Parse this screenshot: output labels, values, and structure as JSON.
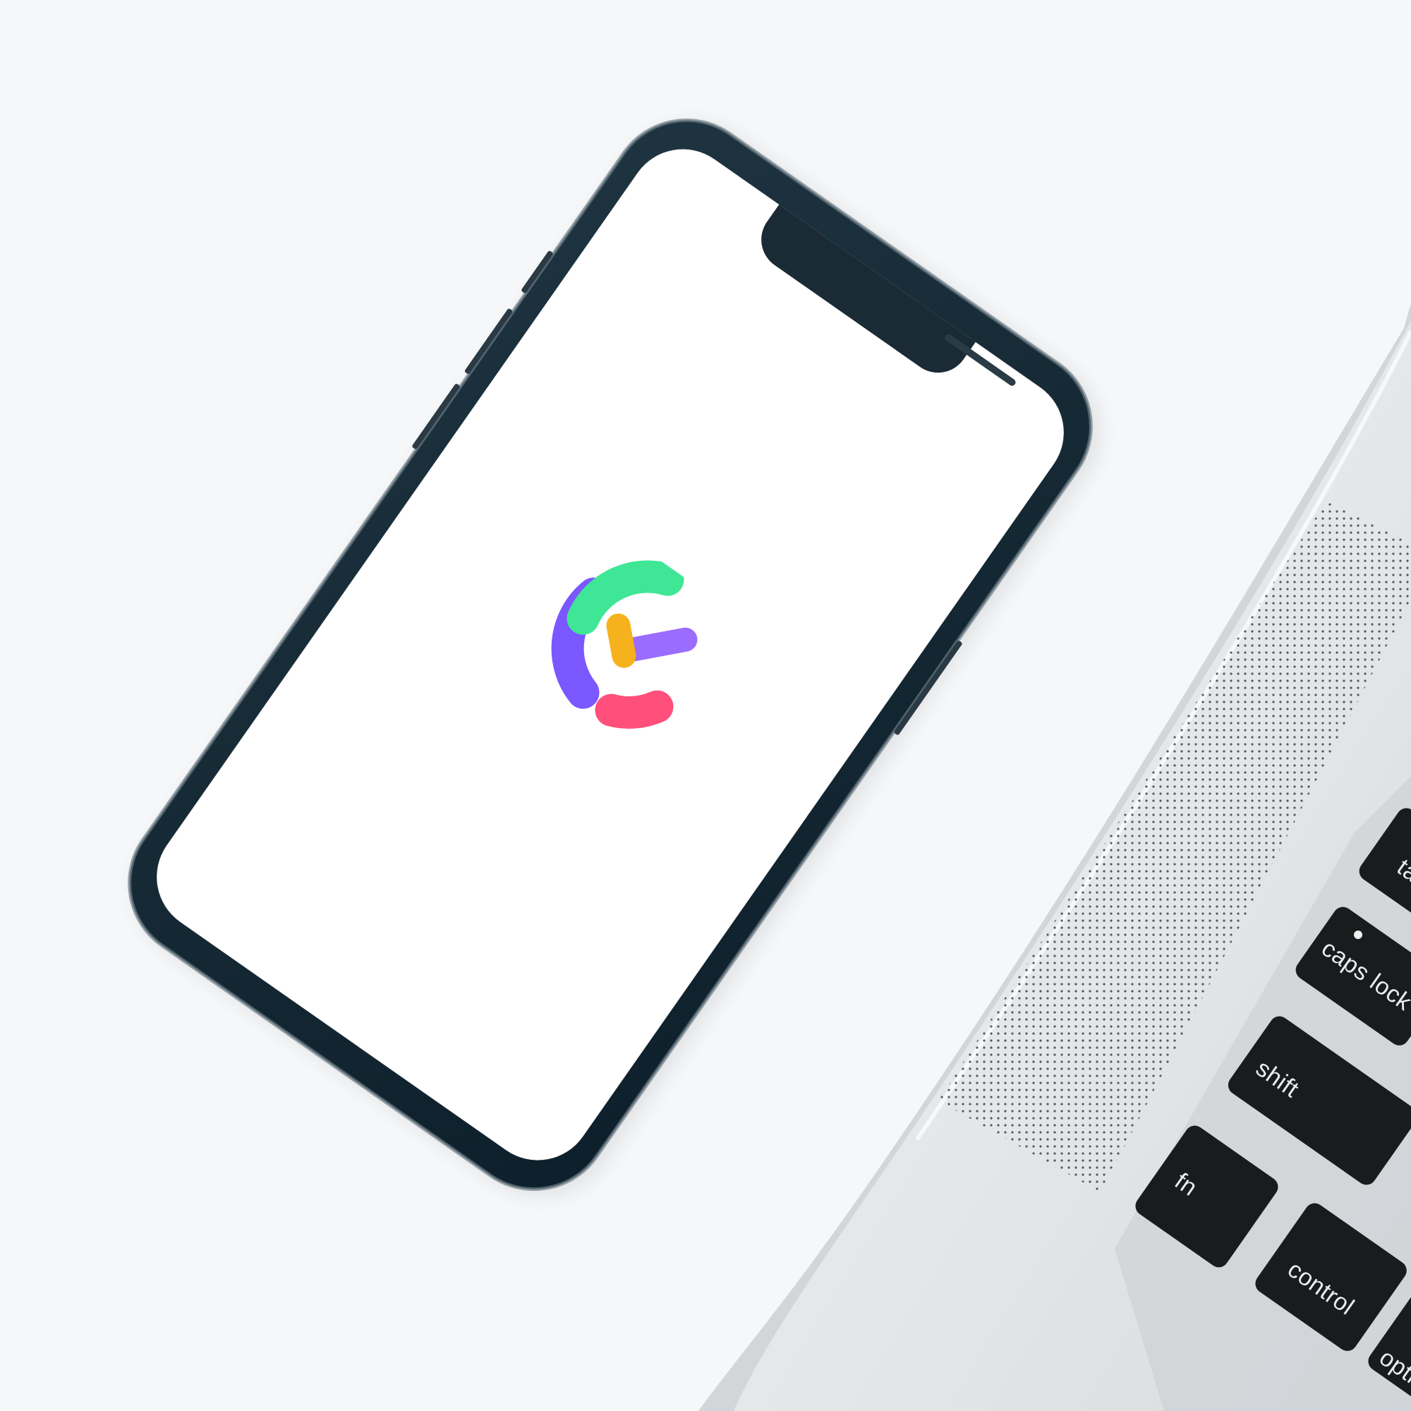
{
  "scene": {
    "background_color": "#f3f4f6",
    "laptop_color": "#e6e8ea",
    "phone_frame_color": "#0f2230",
    "screen_color": "#ffffff"
  },
  "app_logo": {
    "colors": {
      "green": "#3fe695",
      "purple": "#7b57ff",
      "pink": "#ff4f7a",
      "orange": "#f6b21d",
      "violet": "#9a6cff"
    }
  },
  "keyboard": {
    "keys": [
      {
        "label": "tab"
      },
      {
        "label": "caps lock"
      },
      {
        "label": "shift"
      },
      {
        "label": "fn"
      },
      {
        "label": "control"
      },
      {
        "label": "option"
      }
    ]
  }
}
